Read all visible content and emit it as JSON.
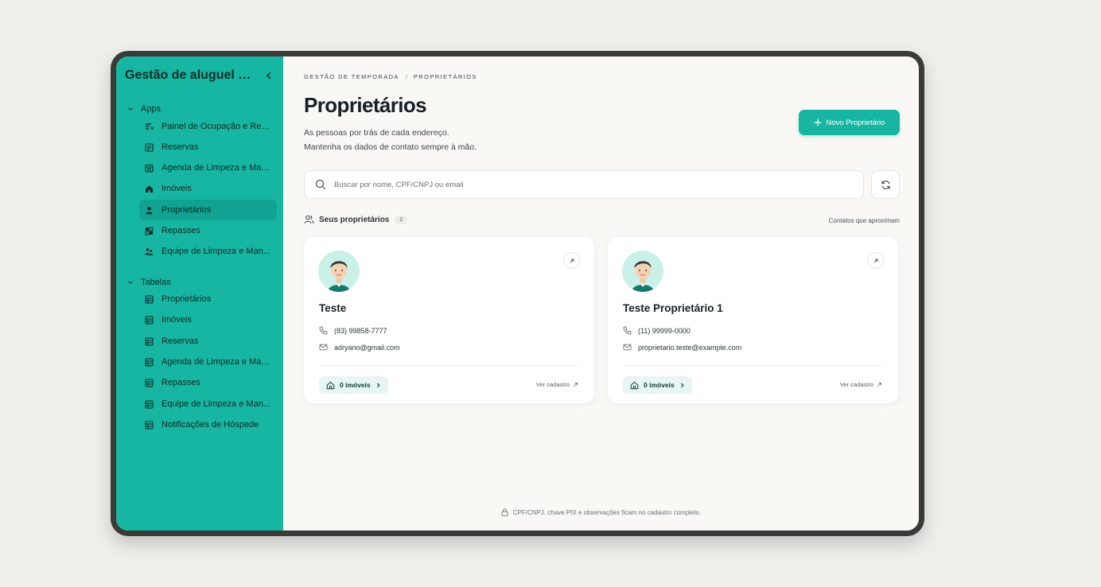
{
  "sidebar": {
    "title": "Gestão de aluguel p...",
    "groups": [
      {
        "label": "Apps"
      },
      {
        "label": "Tabelas"
      }
    ],
    "apps_items": [
      {
        "label": "Painel de Ocupação e Rec...",
        "icon": "chart-lines-icon"
      },
      {
        "label": "Reservas",
        "icon": "list-icon"
      },
      {
        "label": "Agenda de Limpeza e Man...",
        "icon": "calendar-icon"
      },
      {
        "label": "Imóveis",
        "icon": "home-icon"
      },
      {
        "label": "Proprietários",
        "icon": "user-icon"
      },
      {
        "label": "Repasses",
        "icon": "grid-icon"
      },
      {
        "label": "Equipe de Limpeza e Man...",
        "icon": "team-icon"
      }
    ],
    "table_items": [
      {
        "label": "Proprietários"
      },
      {
        "label": "Imóveis"
      },
      {
        "label": "Reservas"
      },
      {
        "label": "Agenda de Limpeza e Man..."
      },
      {
        "label": "Repasses"
      },
      {
        "label": "Equipe de Limpeza e Man..."
      },
      {
        "label": "Notificações de Hóspede"
      }
    ]
  },
  "breadcrumb": {
    "root": "GESTÃO DE TEMPORADA",
    "separator": "/",
    "current": "PROPRIETÁRIOS"
  },
  "header": {
    "title": "Proprietários",
    "subtitle_line1": "As pessoas por trás de cada endereço.",
    "subtitle_line2": "Mantenha os dados de contato sempre à mão.",
    "new_button": "Novo Proprietário"
  },
  "search": {
    "placeholder": "Buscar por nome, CPF/CNPJ ou email"
  },
  "list": {
    "heading": "Seus proprietários",
    "count": "2",
    "note": "Contatos que aproximam"
  },
  "owners": [
    {
      "name": "Teste",
      "phone": "(83) 99858-7777",
      "email": "adryano@gmail.com",
      "properties": "0 imóveis",
      "see_link": "Ver cadastro"
    },
    {
      "name": "Teste Proprietário 1",
      "phone": "(11) 99999-0000",
      "email": "proprietario.teste@example.com",
      "properties": "0 imóveis",
      "see_link": "Ver cadastro"
    }
  ],
  "footer": {
    "note": "CPF/CNPJ, chave PIX e observações ficam no cadastro completo."
  },
  "colors": {
    "accent": "#17b6a2",
    "background": "#f9f8f5",
    "frame": "#3a3a37"
  }
}
